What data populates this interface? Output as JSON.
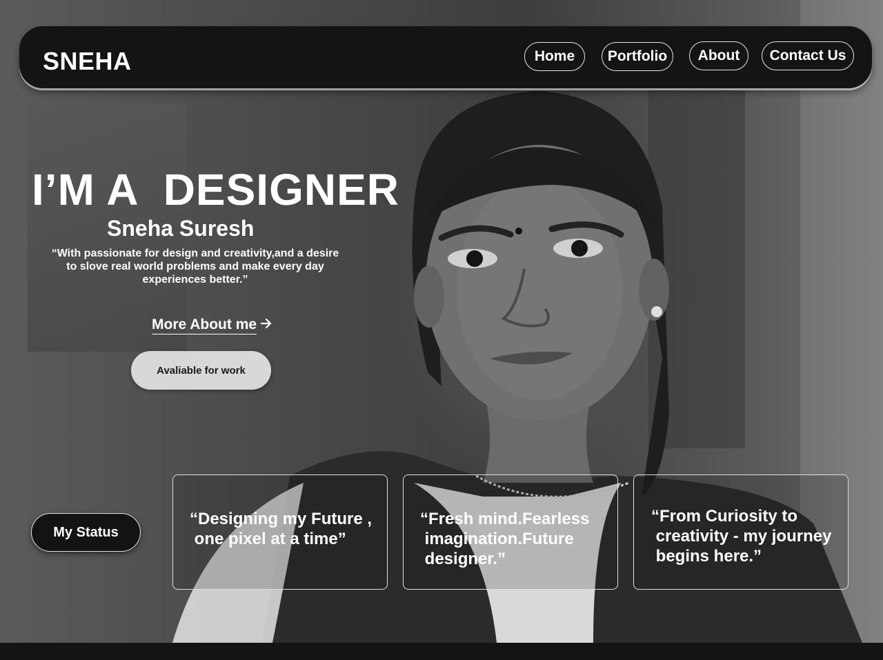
{
  "header": {
    "brand": "SNEHA",
    "nav": [
      {
        "label": "Home"
      },
      {
        "label": "Portfolio"
      },
      {
        "label": "About"
      },
      {
        "label": "Contact  Us"
      }
    ]
  },
  "hero": {
    "headline": "I’M A  DESIGNER",
    "name": "Sneha Suresh",
    "quote": "“With passionate  for design and creativity,and a desire to slove real world problems and make every day experiences better.”",
    "more_link": "More About me",
    "more_icon": "arrow-right-icon",
    "available_button": "Avaliable for work"
  },
  "status": {
    "button": "My Status",
    "cards": [
      {
        "text": "“Designing my Future ,\n one pixel at a time”"
      },
      {
        "text": "“Fresh mind.Fearless\n imagination.Future\n designer.”"
      },
      {
        "text": "“From Curiosity to\n creativity - my journey\n begins here.”"
      }
    ]
  },
  "colors": {
    "navbar_bg": "#161314",
    "button_light": "#d8d8d8",
    "text": "#ffffff"
  }
}
